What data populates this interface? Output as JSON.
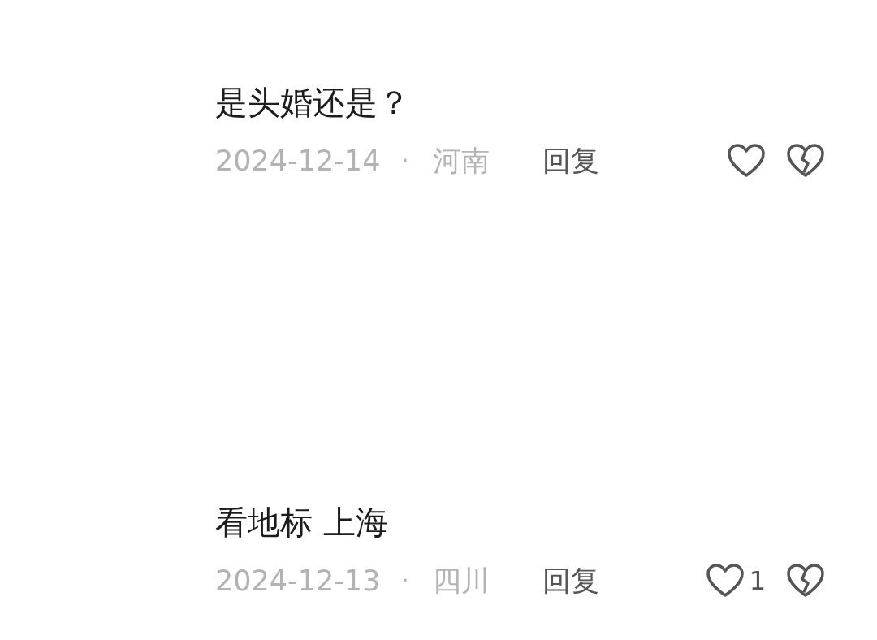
{
  "comments": [
    {
      "text": "是头婚还是？",
      "date": "2024-12-14",
      "separator": "·",
      "location": "河南",
      "reply": "回复"
    },
    {
      "text": "看地标 上海",
      "date": "2024-12-13",
      "separator": "·",
      "location": "四川",
      "reply": "回复",
      "likes": "1"
    }
  ]
}
